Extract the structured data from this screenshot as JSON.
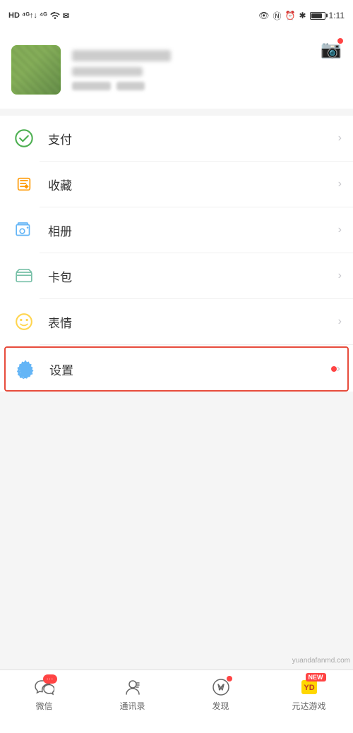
{
  "statusBar": {
    "carrier": "HD",
    "signal": "4G",
    "signal2": "4G",
    "time": "1:11",
    "icons": [
      "eye",
      "notification",
      "alarm",
      "bluetooth",
      "battery"
    ]
  },
  "profile": {
    "cameraLabel": "相机"
  },
  "menu": {
    "items": [
      {
        "id": "pay",
        "label": "支付",
        "icon": "pay-icon"
      },
      {
        "id": "favorites",
        "label": "收藏",
        "icon": "favorites-icon"
      },
      {
        "id": "photos",
        "label": "相册",
        "icon": "photos-icon"
      },
      {
        "id": "wallet",
        "label": "卡包",
        "icon": "wallet-icon"
      },
      {
        "id": "emoji",
        "label": "表情",
        "icon": "emoji-icon"
      },
      {
        "id": "settings",
        "label": "设置",
        "icon": "settings-icon",
        "hasDot": true,
        "highlighted": true
      }
    ]
  },
  "bottomNav": {
    "items": [
      {
        "id": "wechat",
        "label": "微信",
        "icon": "chat-icon",
        "badge": "···"
      },
      {
        "id": "contacts",
        "label": "通讯录",
        "icon": "contacts-icon",
        "badge": null
      },
      {
        "id": "discover",
        "label": "发现",
        "icon": "discover-icon",
        "dot": true
      },
      {
        "id": "profile",
        "label": "元达游戏",
        "icon": "profile-icon",
        "isNew": true
      }
    ]
  },
  "watermark": {
    "text": "yuandafanmd.com"
  }
}
